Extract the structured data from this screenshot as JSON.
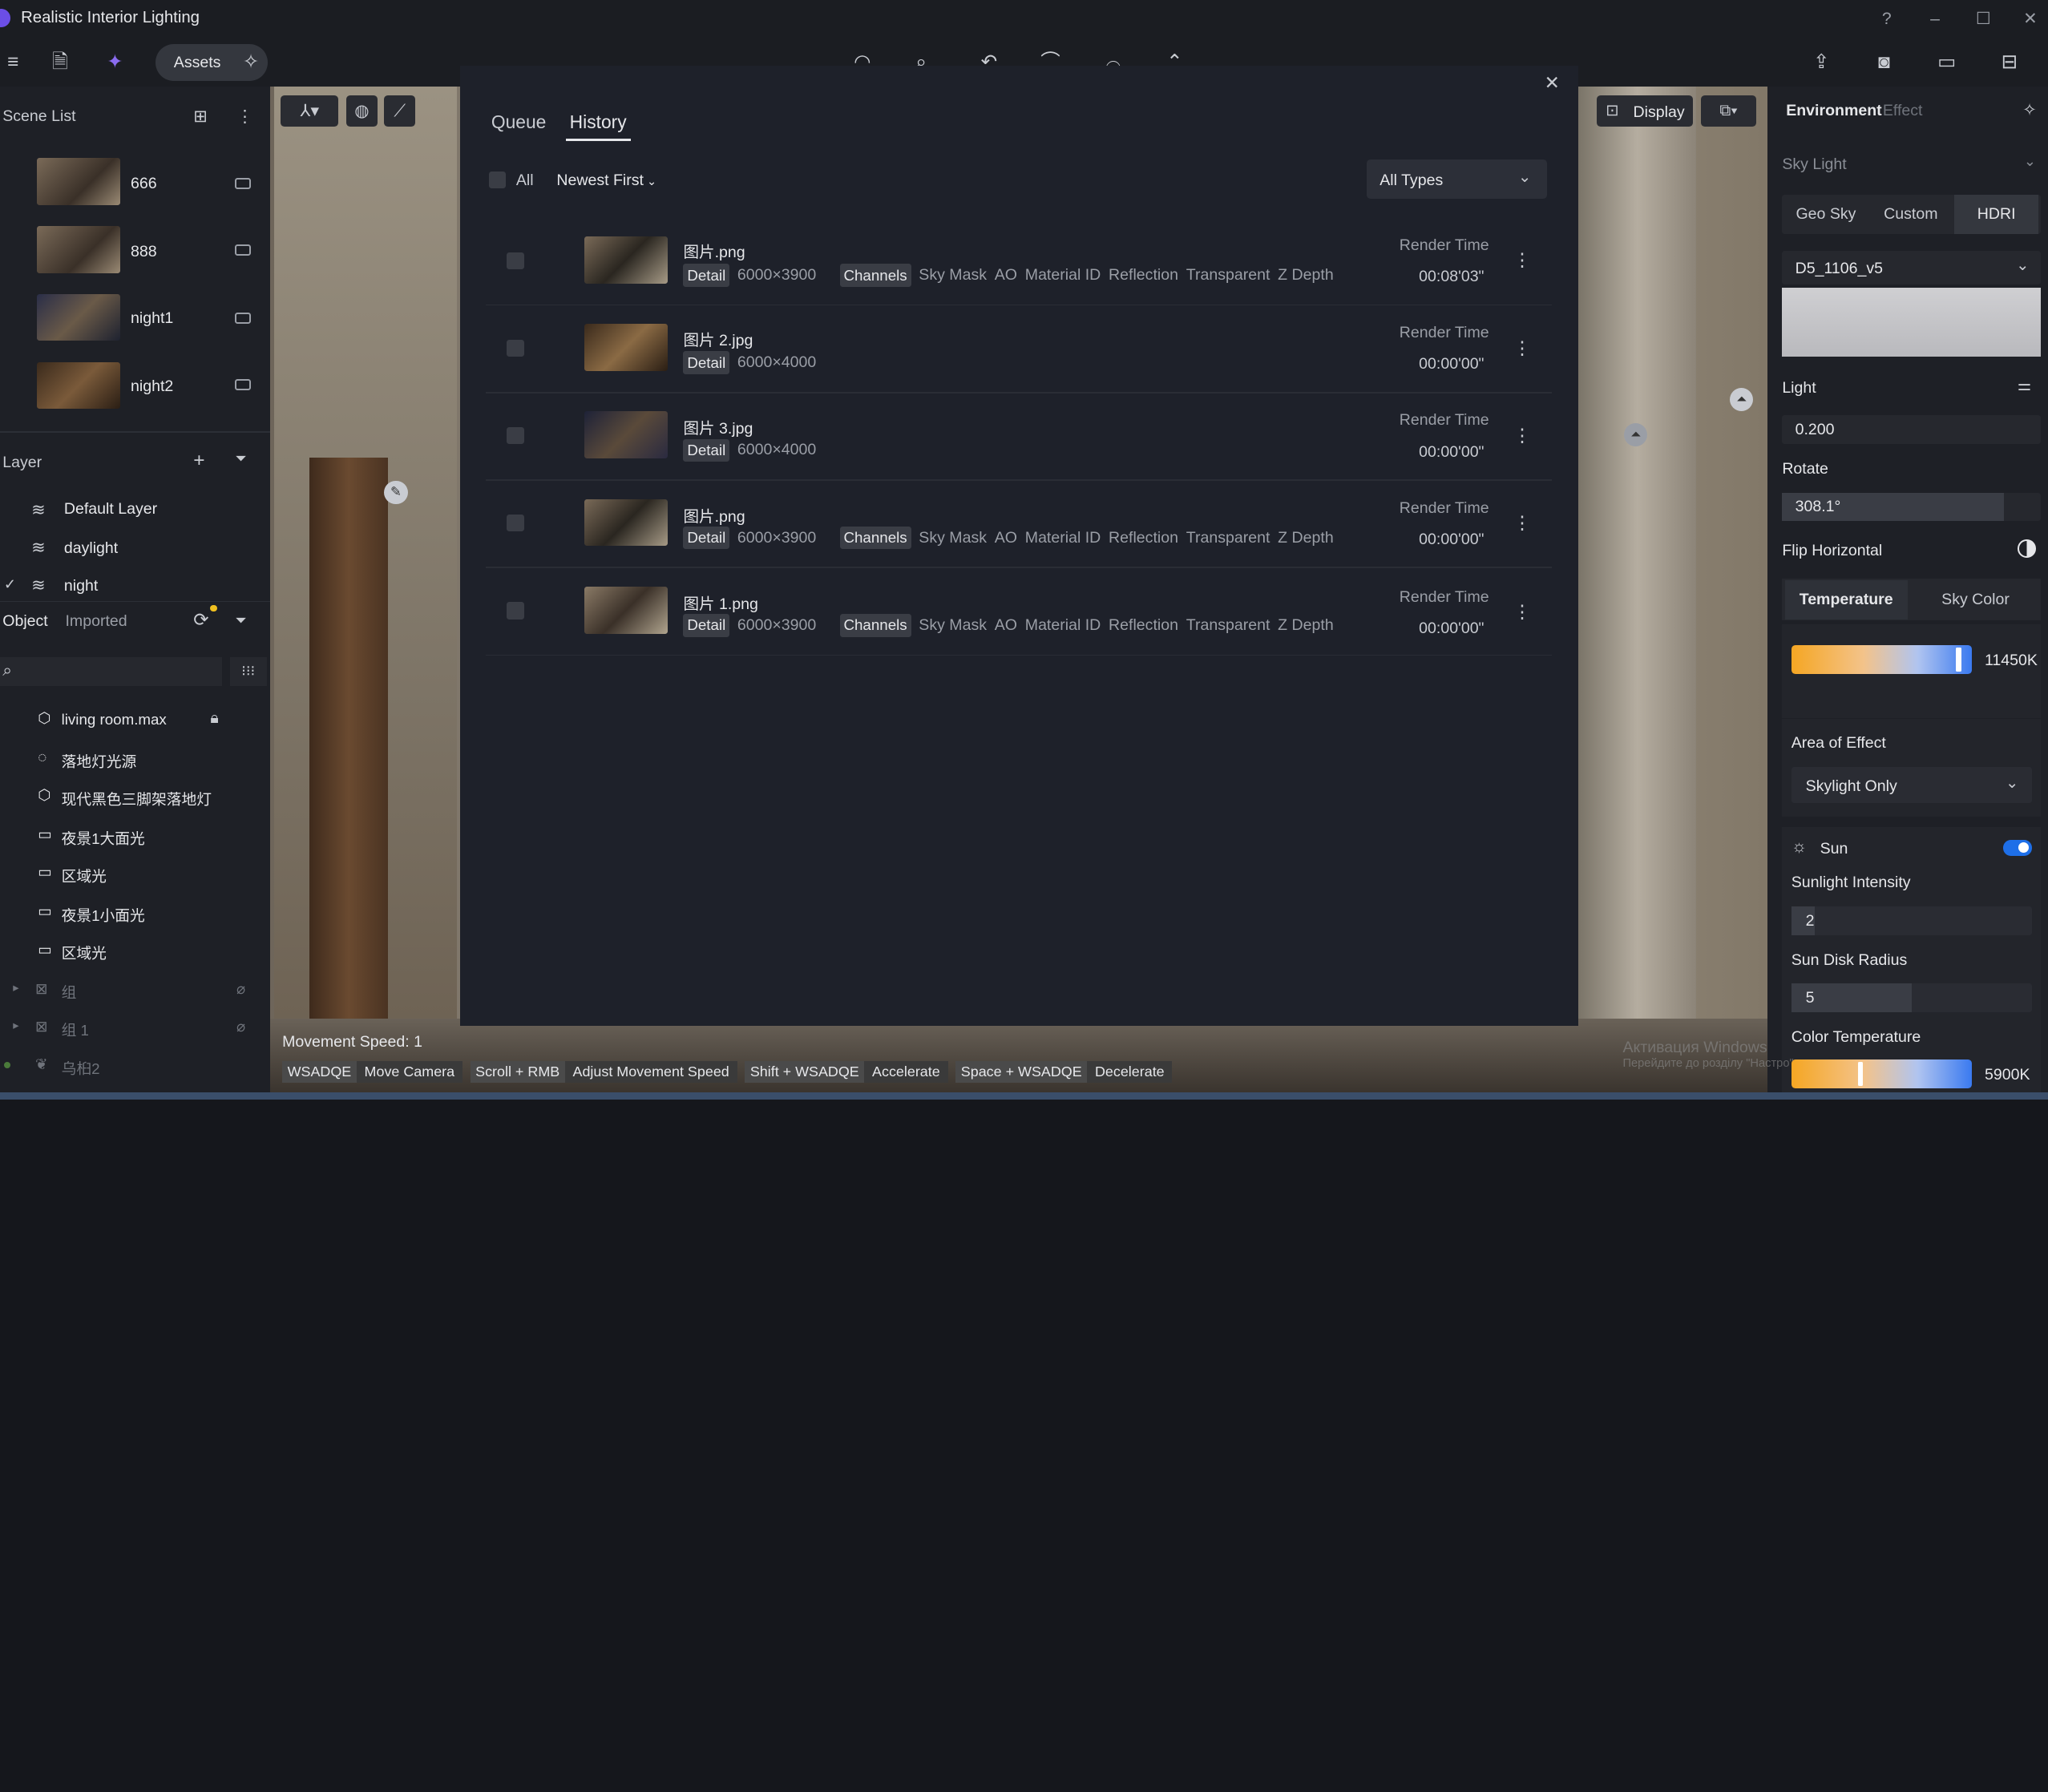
{
  "app": {
    "title": "Realistic Interior Lighting"
  },
  "toolbar": {
    "assets_label": "Assets"
  },
  "scene_list": {
    "title": "Scene List",
    "items": [
      {
        "label": "666"
      },
      {
        "label": "888"
      },
      {
        "label": "night1"
      },
      {
        "label": "night2"
      }
    ]
  },
  "layer": {
    "title": "Layer",
    "items": [
      {
        "label": "Default Layer"
      },
      {
        "label": "daylight"
      },
      {
        "label": "night"
      }
    ]
  },
  "object": {
    "tabs": [
      {
        "label": "Object"
      },
      {
        "label": "Imported"
      }
    ],
    "items": [
      {
        "label": "living room.max",
        "icon": "cube-icon"
      },
      {
        "label": "落地灯光源",
        "icon": "bulb-icon"
      },
      {
        "label": "现代黑色三脚架落地灯",
        "icon": "cube-icon"
      },
      {
        "label": "夜景1大面光",
        "icon": "rect-light-icon"
      },
      {
        "label": "区域光",
        "icon": "rect-light-icon"
      },
      {
        "label": "夜景1小面光",
        "icon": "rect-light-icon"
      },
      {
        "label": "区域光",
        "icon": "rect-light-icon"
      },
      {
        "label": "组",
        "icon": "group-icon"
      },
      {
        "label": "组 1",
        "icon": "group-icon"
      },
      {
        "label": "乌桕2",
        "icon": "plant-icon"
      }
    ]
  },
  "viewport": {
    "display_label": "Display"
  },
  "dialog": {
    "tabs": [
      {
        "label": "Queue"
      },
      {
        "label": "History"
      }
    ],
    "all_label": "All",
    "sort_label": "Newest First",
    "types_label": "All Types",
    "render_time_label": "Render Time",
    "detail_label": "Detail",
    "channels_label": "Channels",
    "rows": [
      {
        "name": "图片.png",
        "size": "6000×3900",
        "channels": [
          "Sky Mask",
          "AO",
          "Material ID",
          "Reflection",
          "Transparent",
          "Z Depth"
        ],
        "time": "00:08'03\""
      },
      {
        "name": "图片 2.jpg",
        "size": "6000×4000",
        "channels": [],
        "time": "00:00'00\""
      },
      {
        "name": "图片 3.jpg",
        "size": "6000×4000",
        "channels": [],
        "time": "00:00'00\""
      },
      {
        "name": "图片.png",
        "size": "6000×3900",
        "channels": [
          "Sky Mask",
          "AO",
          "Material ID",
          "Reflection",
          "Transparent",
          "Z Depth"
        ],
        "time": "00:00'00\""
      },
      {
        "name": "图片 1.png",
        "size": "6000×3900",
        "channels": [
          "Sky Mask",
          "AO",
          "Material ID",
          "Reflection",
          "Transparent",
          "Z Depth"
        ],
        "time": "00:00'00\""
      }
    ]
  },
  "right": {
    "tabs": [
      {
        "label": "Environment"
      },
      {
        "label": "Effect"
      }
    ],
    "sky_light": "Sky Light",
    "sky_modes": [
      {
        "label": "Geo Sky"
      },
      {
        "label": "Custom"
      },
      {
        "label": "HDRI"
      }
    ],
    "hdri_name": "D5_1106_v5",
    "light_label": "Light",
    "light_value": "0.200",
    "rotate_label": "Rotate",
    "rotate_value": "308.1°",
    "rotate_fraction": 0.856,
    "flip_label": "Flip Horizontal",
    "temp_tabs": [
      {
        "label": "Temperature"
      },
      {
        "label": "Sky Color"
      }
    ],
    "temp_value": "11450K",
    "area_label": "Area of Effect",
    "area_value": "Skylight Only",
    "sun_label": "Sun",
    "sun_intensity_label": "Sunlight Intensity",
    "sun_intensity_value": "2",
    "sun_disk_label": "Sun Disk Radius",
    "sun_disk_value": "5",
    "color_temp_label": "Color Temperature",
    "color_temp_value": "5900K"
  },
  "status": {
    "speed": "Movement Speed: 1",
    "shortcuts": [
      {
        "key": "WSADQE",
        "desc": "Move Camera"
      },
      {
        "key": "Scroll + RMB",
        "desc": "Adjust Movement Speed"
      },
      {
        "key": "Shift + WSADQE",
        "desc": "Accelerate"
      },
      {
        "key": "Space + WSADQE",
        "desc": "Decelerate"
      }
    ]
  },
  "watermark": {
    "line1": "Активация Windows",
    "line2": "Перейдите до розділу \"Настро\""
  },
  "colors": {
    "accent": "#1e6fe8",
    "dialog_bg": "#1e212a",
    "panel_bg": "#1e2026"
  }
}
